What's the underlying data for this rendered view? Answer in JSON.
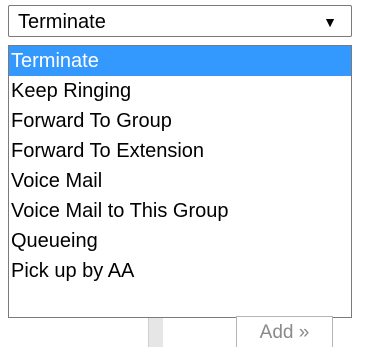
{
  "select": {
    "value": "Terminate",
    "arrow_icon": "triangle-down-icon"
  },
  "options": [
    {
      "label": "Terminate",
      "selected": true
    },
    {
      "label": "Keep Ringing",
      "selected": false
    },
    {
      "label": "Forward To Group",
      "selected": false
    },
    {
      "label": "Forward To Extension",
      "selected": false
    },
    {
      "label": "Voice Mail",
      "selected": false
    },
    {
      "label": "Voice Mail to This Group",
      "selected": false
    },
    {
      "label": "Queueing",
      "selected": false
    },
    {
      "label": "Pick up by AA",
      "selected": false
    }
  ],
  "add_button": {
    "label": "Add »"
  },
  "colors": {
    "highlight": "#3399ff",
    "border": "#7a7a7a"
  }
}
